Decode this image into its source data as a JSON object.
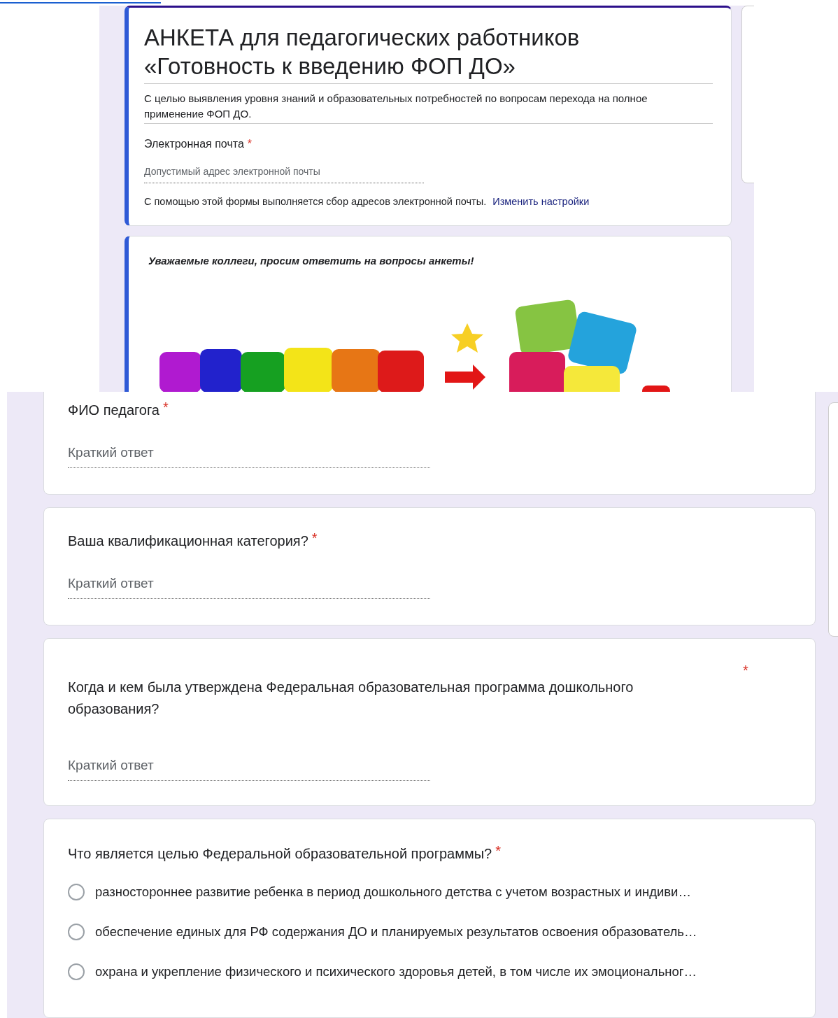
{
  "form_header": {
    "title": "АНКЕТА для педагогических работников «Готовность к введению ФОП ДО»",
    "description": "С целью выявления уровня знаний и образовательных потребностей по вопросам перехода на полное применение ФОП ДО.",
    "email_label": "Электронная почта",
    "email_required_mark": "*",
    "email_placeholder": "Допустимый адрес электронной почты",
    "collect_note": "С помощью этой формы выполняется сбор адресов электронной почты.",
    "settings_link": "Изменить настройки"
  },
  "intro": {
    "text": "Уважаемые коллеги, просим ответить на вопросы анкеты!"
  },
  "questions": [
    {
      "kind": "text",
      "title": "ФИО педагога",
      "required_mark": "*",
      "placeholder": "Краткий ответ"
    },
    {
      "kind": "text",
      "title": "Ваша квалификационная категория?",
      "required_mark": "*",
      "placeholder": "Краткий ответ"
    },
    {
      "kind": "text",
      "title": "Когда и кем была утверждена Федеральная образовательная программа дошкольного образования?",
      "required_mark": "*",
      "placeholder": "Краткий ответ"
    },
    {
      "kind": "radio",
      "title": "Что является целью Федеральной образовательной программы?",
      "required_mark": "*",
      "options": [
        {
          "label": "разностороннее развитие ребенка в период дошкольного детства с учетом возрастных и индиви…",
          "selected": false
        },
        {
          "label": "обеспечение единых для РФ содержания ДО и планируемых результатов освоения образователь…",
          "selected": false
        },
        {
          "label": "охрана и укрепление физического и психического здоровья детей, в том числе их эмоциональног…",
          "selected": false
        }
      ]
    }
  ]
}
